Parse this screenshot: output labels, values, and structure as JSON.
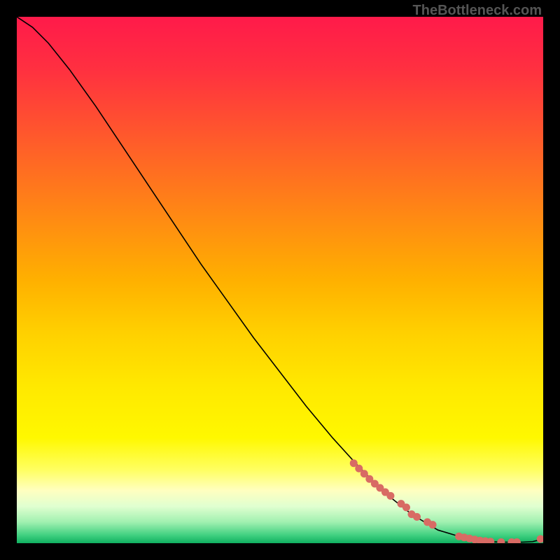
{
  "watermark": "TheBottleneck.com",
  "chart_data": {
    "type": "line",
    "title": "",
    "xlabel": "",
    "ylabel": "",
    "xlim": [
      0,
      100
    ],
    "ylim": [
      0,
      100
    ],
    "series": [
      {
        "name": "curve",
        "x": [
          0,
          3,
          6,
          10,
          15,
          20,
          25,
          30,
          35,
          40,
          45,
          50,
          55,
          60,
          65,
          70,
          75,
          80,
          85,
          88,
          90,
          92,
          94,
          96,
          98,
          100
        ],
        "y": [
          100,
          98,
          95,
          90,
          83,
          75.5,
          68,
          60.5,
          53,
          46,
          39,
          32.5,
          26,
          20,
          14.5,
          9.5,
          5.5,
          2.5,
          1.0,
          0.5,
          0.3,
          0.2,
          0.2,
          0.2,
          0.3,
          0.8
        ]
      }
    ],
    "marker_points": {
      "name": "markers",
      "color": "#d86b64",
      "x": [
        64,
        65,
        66,
        67,
        68,
        69,
        70,
        71,
        73,
        74,
        75,
        76,
        78,
        79,
        84,
        85,
        86,
        87,
        88,
        89,
        90,
        92,
        94,
        95,
        99.5
      ],
      "y": [
        15.2,
        14.2,
        13.2,
        12.2,
        11.3,
        10.5,
        9.7,
        9.0,
        7.5,
        6.8,
        5.5,
        5.0,
        4.0,
        3.5,
        1.3,
        1.1,
        0.9,
        0.7,
        0.5,
        0.4,
        0.3,
        0.2,
        0.2,
        0.2,
        0.8
      ]
    },
    "gradient_stops": [
      {
        "offset": 0.0,
        "color": "#ff1a4a"
      },
      {
        "offset": 0.1,
        "color": "#ff3040"
      },
      {
        "offset": 0.2,
        "color": "#ff5030"
      },
      {
        "offset": 0.3,
        "color": "#ff7020"
      },
      {
        "offset": 0.4,
        "color": "#ff9010"
      },
      {
        "offset": 0.5,
        "color": "#ffb000"
      },
      {
        "offset": 0.6,
        "color": "#ffd000"
      },
      {
        "offset": 0.7,
        "color": "#ffe800"
      },
      {
        "offset": 0.8,
        "color": "#fff800"
      },
      {
        "offset": 0.86,
        "color": "#ffff60"
      },
      {
        "offset": 0.9,
        "color": "#ffffc0"
      },
      {
        "offset": 0.93,
        "color": "#e0ffd0"
      },
      {
        "offset": 0.96,
        "color": "#a0f0b0"
      },
      {
        "offset": 0.985,
        "color": "#40d080"
      },
      {
        "offset": 1.0,
        "color": "#10b060"
      }
    ]
  }
}
